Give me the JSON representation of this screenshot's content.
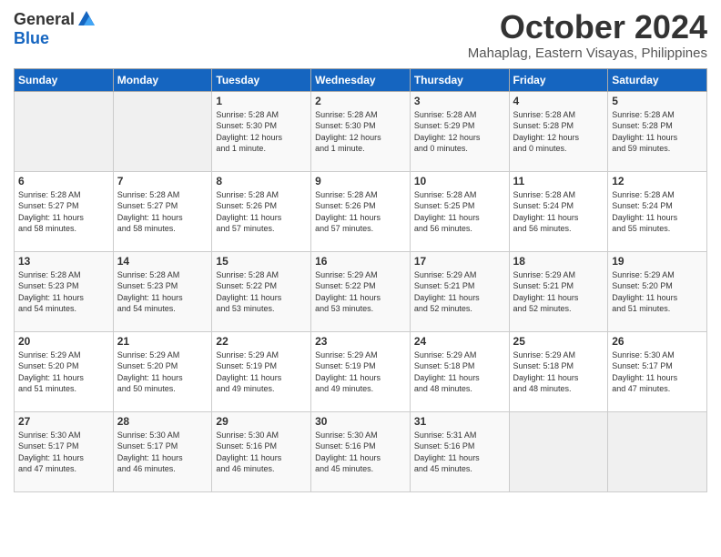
{
  "logo": {
    "general": "General",
    "blue": "Blue"
  },
  "title": "October 2024",
  "subtitle": "Mahaplag, Eastern Visayas, Philippines",
  "days_header": [
    "Sunday",
    "Monday",
    "Tuesday",
    "Wednesday",
    "Thursday",
    "Friday",
    "Saturday"
  ],
  "weeks": [
    [
      {
        "day": "",
        "info": ""
      },
      {
        "day": "",
        "info": ""
      },
      {
        "day": "1",
        "info": "Sunrise: 5:28 AM\nSunset: 5:30 PM\nDaylight: 12 hours\nand 1 minute."
      },
      {
        "day": "2",
        "info": "Sunrise: 5:28 AM\nSunset: 5:30 PM\nDaylight: 12 hours\nand 1 minute."
      },
      {
        "day": "3",
        "info": "Sunrise: 5:28 AM\nSunset: 5:29 PM\nDaylight: 12 hours\nand 0 minutes."
      },
      {
        "day": "4",
        "info": "Sunrise: 5:28 AM\nSunset: 5:28 PM\nDaylight: 12 hours\nand 0 minutes."
      },
      {
        "day": "5",
        "info": "Sunrise: 5:28 AM\nSunset: 5:28 PM\nDaylight: 11 hours\nand 59 minutes."
      }
    ],
    [
      {
        "day": "6",
        "info": "Sunrise: 5:28 AM\nSunset: 5:27 PM\nDaylight: 11 hours\nand 58 minutes."
      },
      {
        "day": "7",
        "info": "Sunrise: 5:28 AM\nSunset: 5:27 PM\nDaylight: 11 hours\nand 58 minutes."
      },
      {
        "day": "8",
        "info": "Sunrise: 5:28 AM\nSunset: 5:26 PM\nDaylight: 11 hours\nand 57 minutes."
      },
      {
        "day": "9",
        "info": "Sunrise: 5:28 AM\nSunset: 5:26 PM\nDaylight: 11 hours\nand 57 minutes."
      },
      {
        "day": "10",
        "info": "Sunrise: 5:28 AM\nSunset: 5:25 PM\nDaylight: 11 hours\nand 56 minutes."
      },
      {
        "day": "11",
        "info": "Sunrise: 5:28 AM\nSunset: 5:24 PM\nDaylight: 11 hours\nand 56 minutes."
      },
      {
        "day": "12",
        "info": "Sunrise: 5:28 AM\nSunset: 5:24 PM\nDaylight: 11 hours\nand 55 minutes."
      }
    ],
    [
      {
        "day": "13",
        "info": "Sunrise: 5:28 AM\nSunset: 5:23 PM\nDaylight: 11 hours\nand 54 minutes."
      },
      {
        "day": "14",
        "info": "Sunrise: 5:28 AM\nSunset: 5:23 PM\nDaylight: 11 hours\nand 54 minutes."
      },
      {
        "day": "15",
        "info": "Sunrise: 5:28 AM\nSunset: 5:22 PM\nDaylight: 11 hours\nand 53 minutes."
      },
      {
        "day": "16",
        "info": "Sunrise: 5:29 AM\nSunset: 5:22 PM\nDaylight: 11 hours\nand 53 minutes."
      },
      {
        "day": "17",
        "info": "Sunrise: 5:29 AM\nSunset: 5:21 PM\nDaylight: 11 hours\nand 52 minutes."
      },
      {
        "day": "18",
        "info": "Sunrise: 5:29 AM\nSunset: 5:21 PM\nDaylight: 11 hours\nand 52 minutes."
      },
      {
        "day": "19",
        "info": "Sunrise: 5:29 AM\nSunset: 5:20 PM\nDaylight: 11 hours\nand 51 minutes."
      }
    ],
    [
      {
        "day": "20",
        "info": "Sunrise: 5:29 AM\nSunset: 5:20 PM\nDaylight: 11 hours\nand 51 minutes."
      },
      {
        "day": "21",
        "info": "Sunrise: 5:29 AM\nSunset: 5:20 PM\nDaylight: 11 hours\nand 50 minutes."
      },
      {
        "day": "22",
        "info": "Sunrise: 5:29 AM\nSunset: 5:19 PM\nDaylight: 11 hours\nand 49 minutes."
      },
      {
        "day": "23",
        "info": "Sunrise: 5:29 AM\nSunset: 5:19 PM\nDaylight: 11 hours\nand 49 minutes."
      },
      {
        "day": "24",
        "info": "Sunrise: 5:29 AM\nSunset: 5:18 PM\nDaylight: 11 hours\nand 48 minutes."
      },
      {
        "day": "25",
        "info": "Sunrise: 5:29 AM\nSunset: 5:18 PM\nDaylight: 11 hours\nand 48 minutes."
      },
      {
        "day": "26",
        "info": "Sunrise: 5:30 AM\nSunset: 5:17 PM\nDaylight: 11 hours\nand 47 minutes."
      }
    ],
    [
      {
        "day": "27",
        "info": "Sunrise: 5:30 AM\nSunset: 5:17 PM\nDaylight: 11 hours\nand 47 minutes."
      },
      {
        "day": "28",
        "info": "Sunrise: 5:30 AM\nSunset: 5:17 PM\nDaylight: 11 hours\nand 46 minutes."
      },
      {
        "day": "29",
        "info": "Sunrise: 5:30 AM\nSunset: 5:16 PM\nDaylight: 11 hours\nand 46 minutes."
      },
      {
        "day": "30",
        "info": "Sunrise: 5:30 AM\nSunset: 5:16 PM\nDaylight: 11 hours\nand 45 minutes."
      },
      {
        "day": "31",
        "info": "Sunrise: 5:31 AM\nSunset: 5:16 PM\nDaylight: 11 hours\nand 45 minutes."
      },
      {
        "day": "",
        "info": ""
      },
      {
        "day": "",
        "info": ""
      }
    ]
  ]
}
